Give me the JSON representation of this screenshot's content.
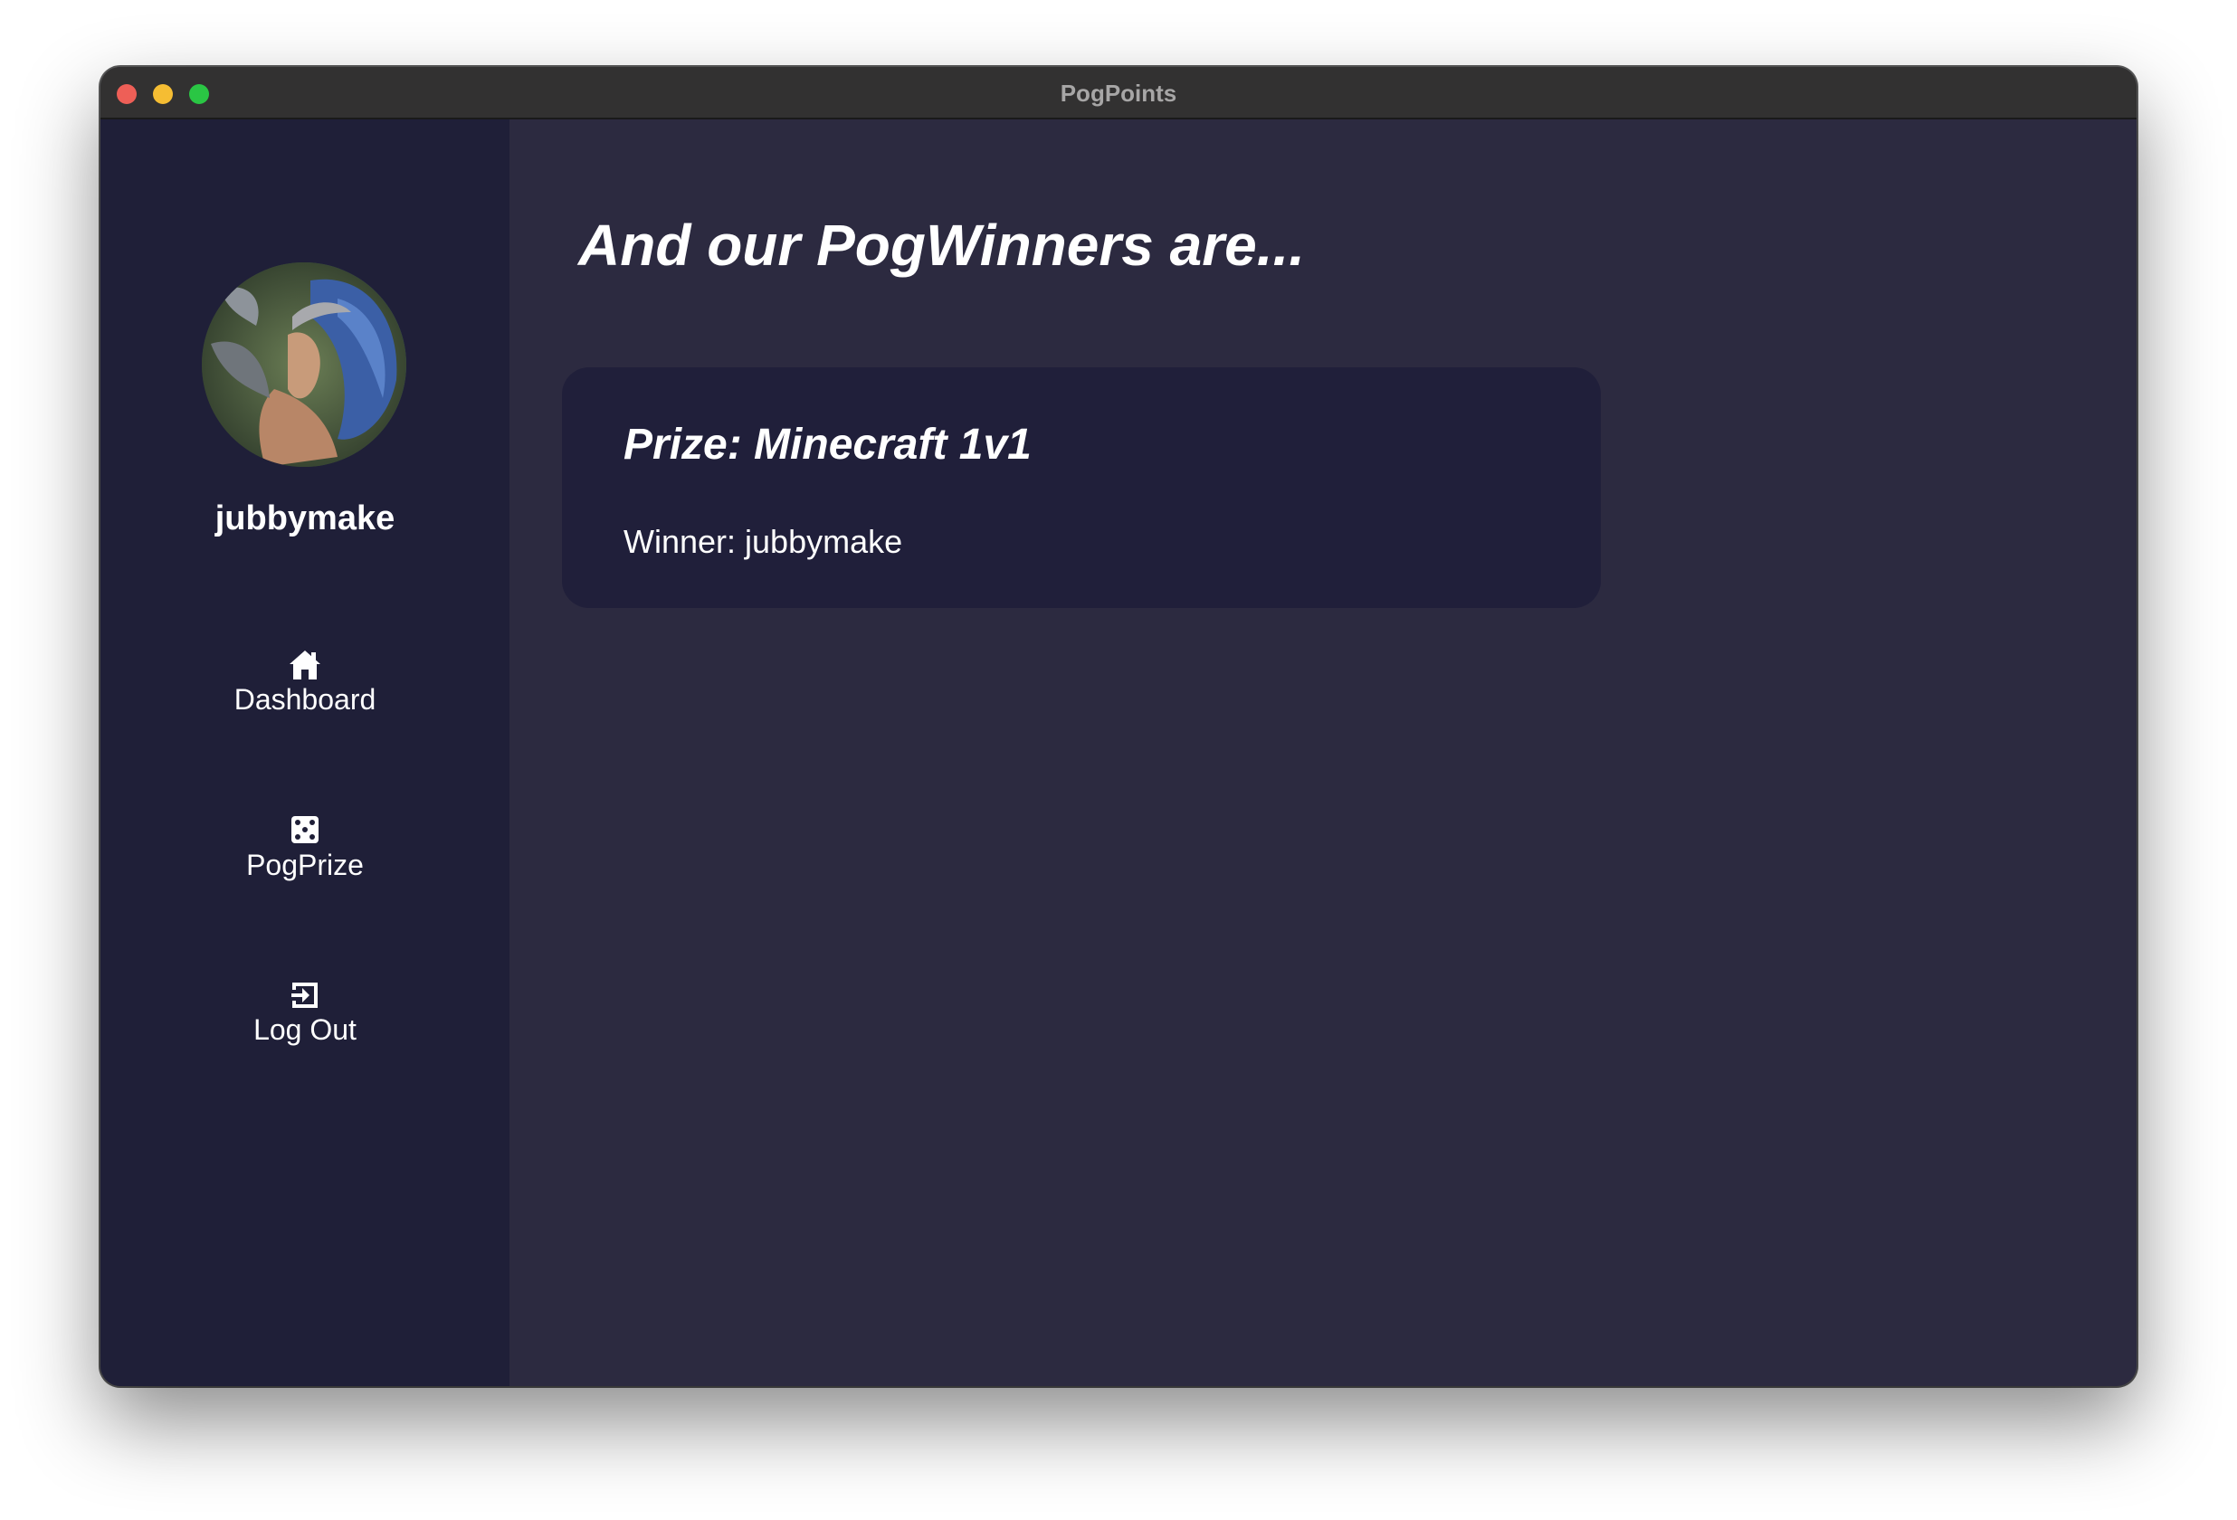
{
  "window": {
    "title": "PogPoints"
  },
  "sidebar": {
    "username": "jubbymake",
    "avatar_icon": "user-avatar",
    "items": [
      {
        "label": "Dashboard",
        "icon": "home-icon"
      },
      {
        "label": "PogPrize",
        "icon": "dice-icon"
      },
      {
        "label": "Log Out",
        "icon": "logout-icon"
      }
    ]
  },
  "main": {
    "heading": "And our PogWinners are...",
    "winners": [
      {
        "prize": "Prize: Minecraft 1v1",
        "winner": "Winner: jubbymake"
      }
    ]
  },
  "colors": {
    "sidebar_bg": "#1f1f38",
    "main_bg": "#2c2a40",
    "card_bg": "#201f3a",
    "text": "#ffffff"
  }
}
